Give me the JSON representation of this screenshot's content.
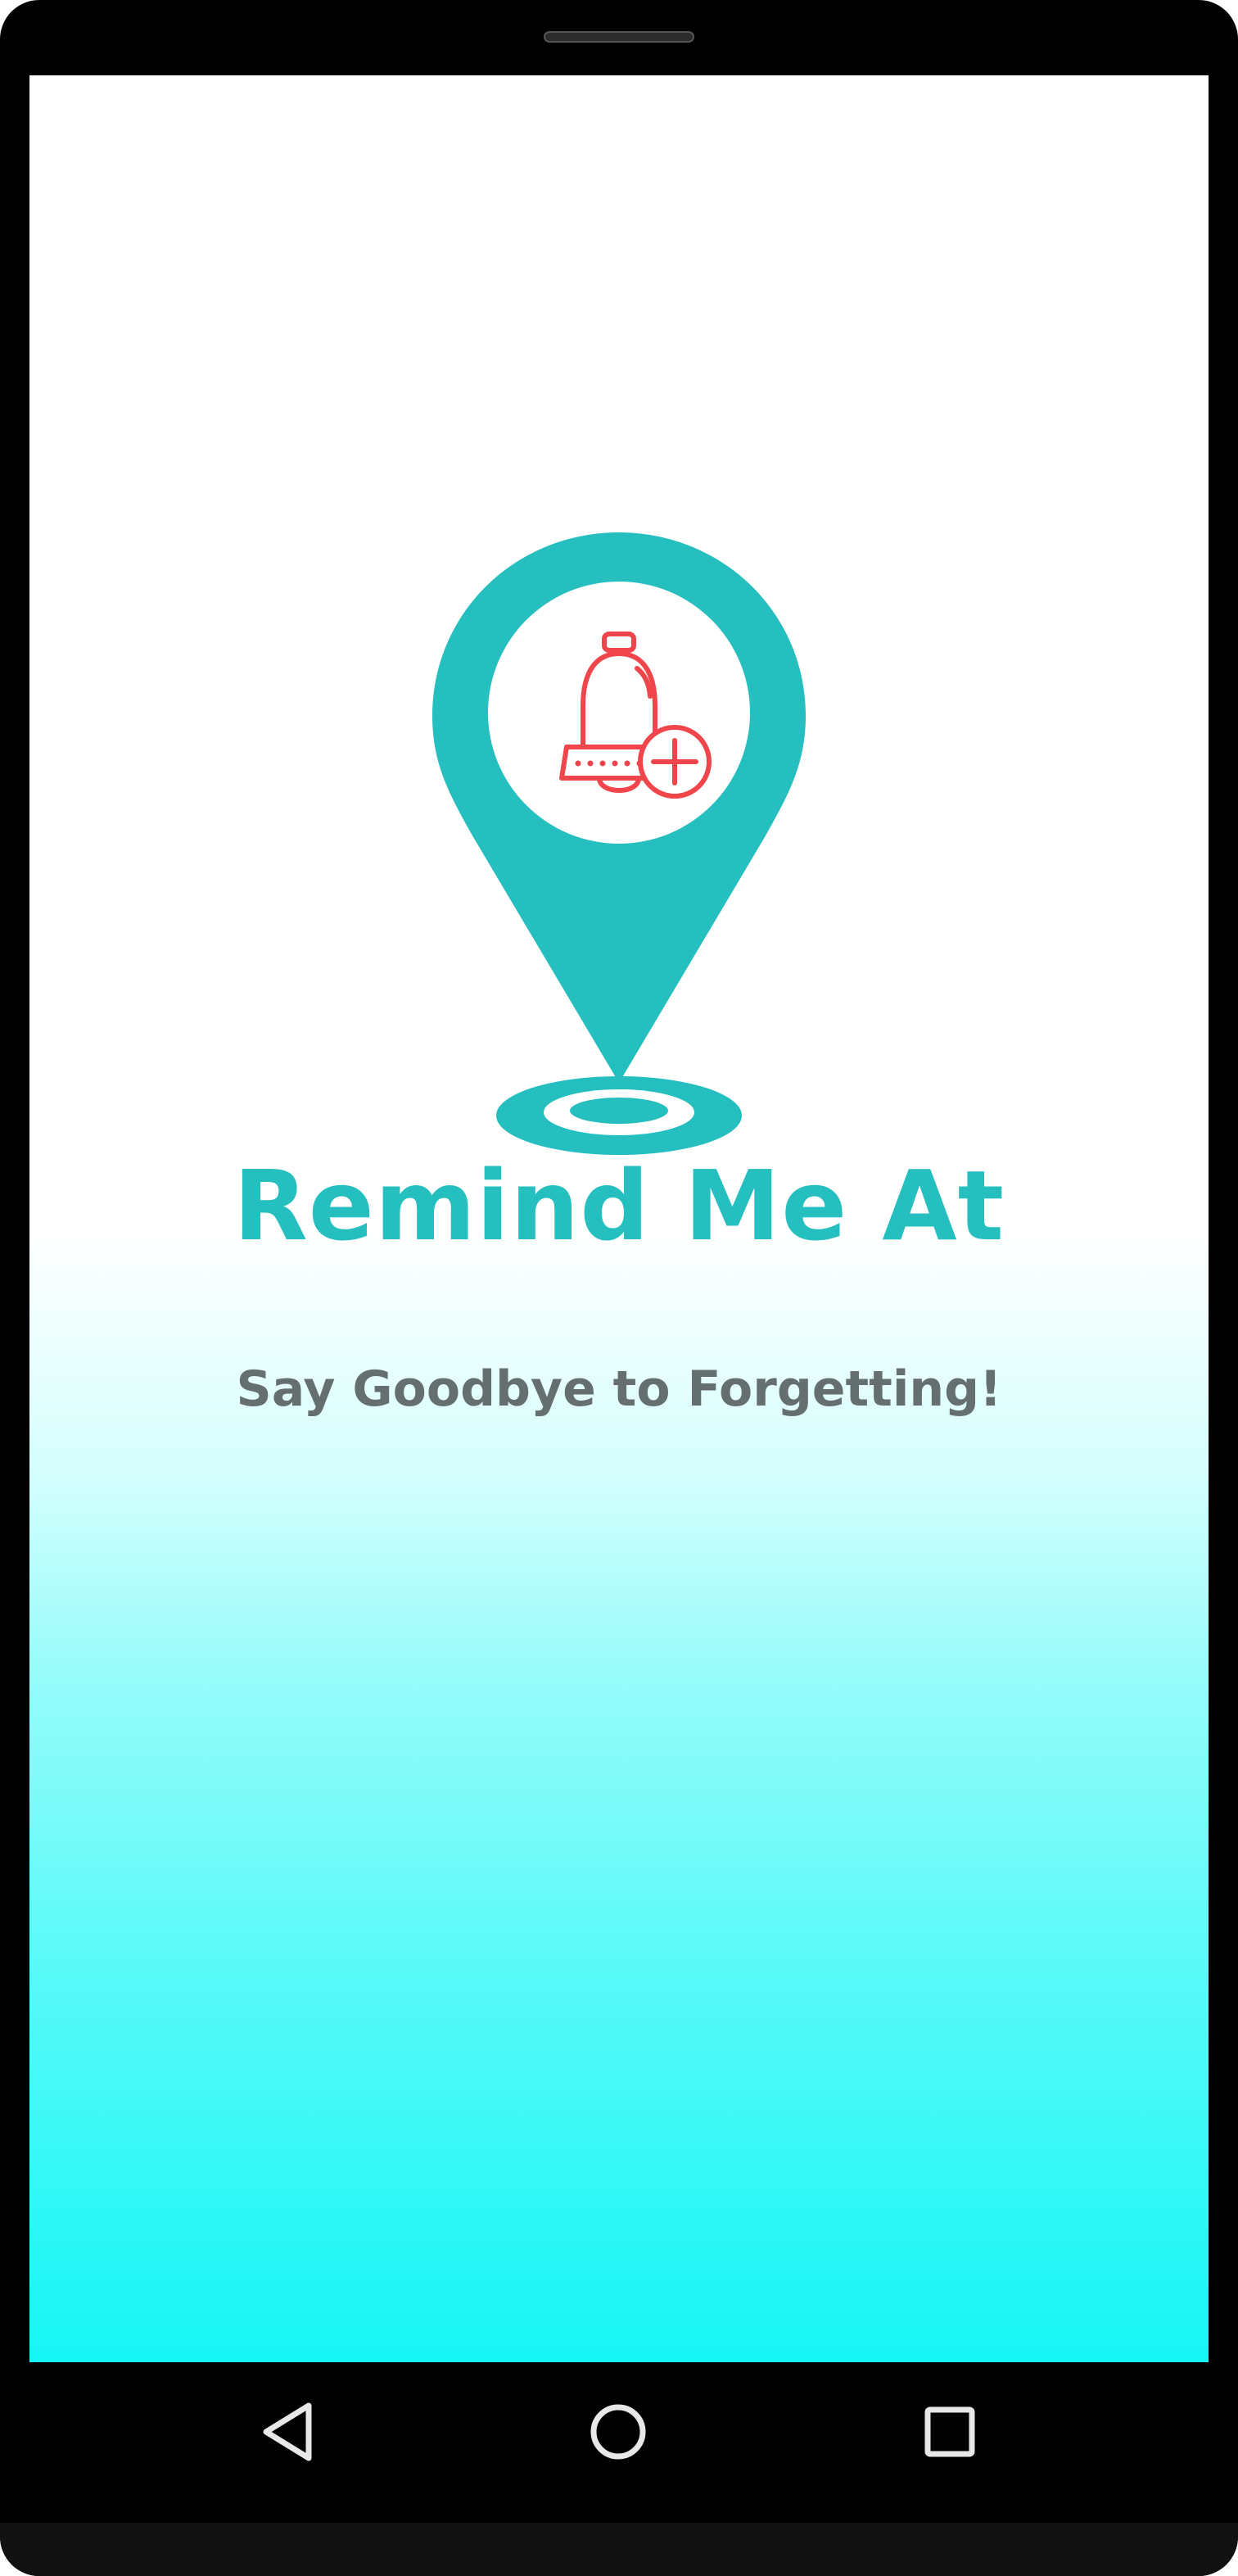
{
  "app": {
    "title": "Remind Me At",
    "tagline": "Say Goodbye to Forgetting!"
  },
  "icons": {
    "logo": "location-pin-bell-icon",
    "nav_back": "triangle-back-icon",
    "nav_home": "circle-home-icon",
    "nav_recents": "square-recents-icon"
  },
  "colors": {
    "brand_teal": "#26bfbf",
    "bell_red": "#f0454b",
    "tagline_gray": "#666f70",
    "gradient_bottom": "#17f5f5"
  }
}
